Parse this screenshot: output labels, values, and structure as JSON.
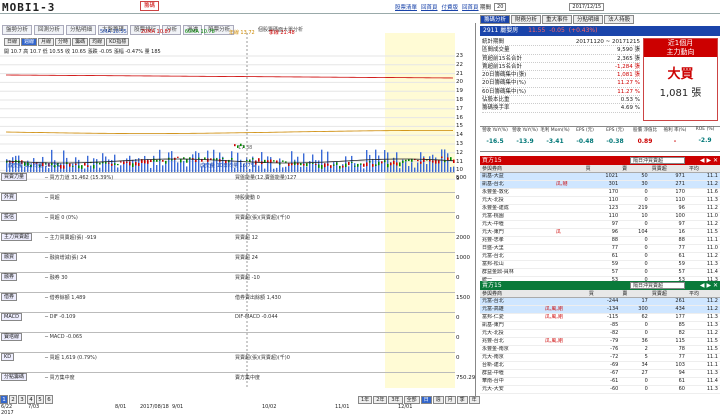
{
  "brand": {
    "logo_text": "MOBI1-3",
    "nav_tabs": [
      "個股",
      "回測分析",
      "分點追蹤",
      "大盤"
    ]
  },
  "header": {
    "tabs": [
      "盤勢分析",
      "回測分析",
      "分點明細",
      "大盤籌碼",
      "股票排行",
      "分析",
      "過濾",
      "股票分析"
    ],
    "active_tab": "籌碼",
    "links": [
      "股票清單",
      "回首頁",
      "付費版",
      "回首頁"
    ],
    "subtitle": "個股籌碼面大單分析"
  },
  "chart": {
    "tabs": [
      "日線",
      "週線",
      "月線",
      "分時",
      "籌碼",
      "均線",
      "KD指標"
    ],
    "active_tab": "日線",
    "ma_legend": [
      {
        "label": "5MA 10.55",
        "color": "#1a44aa"
      },
      {
        "label": "20MA 10.87",
        "color": "#c00"
      },
      {
        "label": "60MA 10.78",
        "color": "#008800"
      },
      {
        "label": "年線 13.72",
        "color": "#cc8800"
      },
      {
        "label": "季線 21.48",
        "color": "#c00"
      }
    ],
    "price_legend": "開 10.7  高 10.7  低 10.55  收 10.65  漲跌 -0.05  漲幅 -0.47%  量 185",
    "y_labels": [
      "23",
      "22",
      "21",
      "20",
      "19",
      "18",
      "17",
      "16",
      "15",
      "14",
      "13",
      "12",
      "11",
      "10",
      "9"
    ],
    "vol_label": "成交量 5日均量 16.7%",
    "vol_label2": "成交量 10日均量 16.7%",
    "crosshair_label": "17.38",
    "panels": [
      {
        "label": "買賣力量",
        "text": "─ 買方力道 31,462 (15.39%)",
        "text2": "買盤能量(12,賣盤能量)127",
        "y": "500"
      },
      {
        "label": "外資",
        "text": "─ 買超",
        "text2": "持股變動 0",
        "y": "0"
      },
      {
        "label": "投信",
        "text": "─ 買超 0 (0%)",
        "text2": "買賣超(張)(買賣超)(千)0",
        "y": "0"
      },
      {
        "label": "主力買賣超",
        "text": "─ 主力買賣超(張) -919",
        "text2": "買賣超 12",
        "y": "2000"
      },
      {
        "label": "融資",
        "text": "─ 融資增減(張) 24",
        "text2": "買賣超 24",
        "y": "1000"
      },
      {
        "label": "融券",
        "text": "─ 融券 30",
        "text2": "買賣超 -10",
        "y": "0"
      },
      {
        "label": "借券",
        "text": "─ 借券餘額 1,489",
        "text2": "借券賣出餘額 1,430",
        "y": "1500"
      },
      {
        "label": "MACD",
        "text": "─ DIF -0.109",
        "text2": "DIF-MACD -0.044",
        "y": "0"
      },
      {
        "label": "寶塔線",
        "text": "─ MACD -0.065",
        "text2": "",
        "y": "0"
      },
      {
        "label": "KD",
        "text": "─ 買超 1,619 (0.79%)",
        "text2": "買賣超(張)(買賣超)(千)0",
        "y": "0"
      },
      {
        "label": "分點籌碼",
        "text": "─ 買方集中度",
        "text2": "賣方集中度",
        "y": "750.29"
      }
    ],
    "x_labels": [
      "6/22\n2017",
      "7/03",
      "8/01",
      "2017/08/18",
      "9/01",
      "10/02",
      "11/01",
      "12/01"
    ],
    "bottom_pages": [
      "1",
      "2",
      "3",
      "4",
      "5",
      "6"
    ],
    "period_tabs": [
      "1年",
      "2年",
      "3年",
      "全部",
      "日",
      "週",
      "月",
      "季",
      "年"
    ]
  },
  "right": {
    "top_label": "期間",
    "top_select": "20",
    "top_date_from": "2017/12/15",
    "tabs": [
      "籌碼分析",
      "財務分析",
      "重大事件",
      "分點明細",
      "法人持股"
    ],
    "active_tab": "籌碼分析",
    "stock": {
      "code": "2911",
      "name": "麗嬰房",
      "price": "11.55",
      "chg": "-0.05",
      "pct": "(+0.43%)"
    },
    "stats": [
      {
        "k": "統計期間",
        "v": "20171120 ~ 20171215"
      },
      {
        "k": "區間成交量",
        "v": "9,590 張"
      },
      {
        "k": "買超前15名合計",
        "v": "2,365 張"
      },
      {
        "k": "賣超前15名合計",
        "v": "-1,284 張"
      },
      {
        "k": "20日籌碼集中(張)",
        "v": "1,081 張"
      },
      {
        "k": "20日籌碼集中(%)",
        "v": "11.27 %"
      },
      {
        "k": "60日籌碼集中(%)",
        "v": "11.27 %"
      },
      {
        "k": "佔股本比重",
        "v": "0.53 %"
      },
      {
        "k": "籌碼換手率",
        "v": "4.69 %"
      }
    ],
    "bigbox": {
      "head1": "近1個月",
      "head2": "主力動向",
      "main": "大買",
      "size": "1,081 張"
    },
    "metrics": [
      {
        "k": "營收 YoY(%)",
        "v": "-16.5"
      },
      {
        "k": "營收 YoY(%)",
        "v": "-13.9"
      },
      {
        "k": "毛利 Mom(%)",
        "v": "-3.41"
      },
      {
        "k": "EPS (元)",
        "v": "-0.48"
      },
      {
        "k": "EPS (元)",
        "v": "-0.38"
      },
      {
        "k": "股價 淨值比",
        "v": "0.89"
      },
      {
        "k": "殖利 率(%)",
        "v": "-"
      },
      {
        "k": "ROE (%)",
        "v": "-2.9"
      }
    ],
    "buy": {
      "title": "買方15",
      "select": "隔日沖買賣超",
      "headers": [
        "參與券商",
        "",
        "買",
        "賣",
        "買賣超",
        "平均"
      ],
      "rows": [
        {
          "name": "凱基-大益",
          "tag": "",
          "b": "1021",
          "s": "50",
          "net": "971",
          "avg": "11.1"
        },
        {
          "name": "凱基-台北",
          "tag": "瓜,剛",
          "b": "301",
          "s": "30",
          "net": "271",
          "avg": "11.2"
        },
        {
          "name": "永豐金-敦化",
          "tag": "",
          "b": "170",
          "s": "0",
          "net": "170",
          "avg": "11.6"
        },
        {
          "name": "元大-北投",
          "tag": "",
          "b": "110",
          "s": "0",
          "net": "110",
          "avg": "11.3"
        },
        {
          "name": "永豐金-建成",
          "tag": "",
          "b": "123",
          "s": "219",
          "net": "96",
          "avg": "11.2"
        },
        {
          "name": "元富-桃園",
          "tag": "",
          "b": "110",
          "s": "10",
          "net": "100",
          "avg": "11.0"
        },
        {
          "name": "元大-中壢",
          "tag": "",
          "b": "97",
          "s": "0",
          "net": "97",
          "avg": "11.2"
        },
        {
          "name": "元大-東門",
          "tag": "瓜",
          "b": "96",
          "s": "104",
          "net": "16",
          "avg": "11.5"
        },
        {
          "name": "兆豐-忠孝",
          "tag": "",
          "b": "88",
          "s": "0",
          "net": "88",
          "avg": "11.1"
        },
        {
          "name": "日盛-大里",
          "tag": "",
          "b": "77",
          "s": "0",
          "net": "77",
          "avg": "11.0"
        },
        {
          "name": "元富-台北",
          "tag": "",
          "b": "61",
          "s": "0",
          "net": "61",
          "avg": "11.2"
        },
        {
          "name": "富邦-松山",
          "tag": "",
          "b": "59",
          "s": "0",
          "net": "59",
          "avg": "11.3"
        },
        {
          "name": "群益金鼎-員林",
          "tag": "",
          "b": "57",
          "s": "0",
          "net": "57",
          "avg": "11.4"
        },
        {
          "name": "統一",
          "tag": "",
          "b": "53",
          "s": "0",
          "net": "53",
          "avg": "11.3"
        },
        {
          "name": "新光",
          "tag": "",
          "b": "50",
          "s": "259",
          "net": "-209",
          "avg": "11.3"
        }
      ]
    },
    "sell": {
      "title": "賣方15",
      "select": "隔日沖買賣超",
      "headers": [
        "參與券商",
        "",
        "買",
        "賣",
        "買賣超",
        "平均"
      ],
      "rows": [
        {
          "name": "元富-台北",
          "tag": "",
          "b": "-244",
          "s": "17",
          "net": "261",
          "avg": "11.2"
        },
        {
          "name": "元富-高雄",
          "tag": "瓜,風,剛",
          "b": "-134",
          "s": "300",
          "net": "434",
          "avg": "11.2"
        },
        {
          "name": "富邦-仁愛",
          "tag": "瓜,風,剛",
          "b": "-115",
          "s": "62",
          "net": "177",
          "avg": "11.3"
        },
        {
          "name": "凱基-東門",
          "tag": "",
          "b": "-85",
          "s": "0",
          "net": "85",
          "avg": "11.3"
        },
        {
          "name": "元大-北投",
          "tag": "",
          "b": "-82",
          "s": "0",
          "net": "82",
          "avg": "11.2"
        },
        {
          "name": "兆豐-台北",
          "tag": "瓜,風,剛",
          "b": "-79",
          "s": "36",
          "net": "115",
          "avg": "11.5"
        },
        {
          "name": "永豐金-南京",
          "tag": "",
          "b": "-76",
          "s": "2",
          "net": "78",
          "avg": "11.5"
        },
        {
          "name": "元大-南京",
          "tag": "",
          "b": "-72",
          "s": "5",
          "net": "77",
          "avg": "11.1"
        },
        {
          "name": "台新-建北",
          "tag": "",
          "b": "-69",
          "s": "34",
          "net": "103",
          "avg": "11.1"
        },
        {
          "name": "群益-中壢",
          "tag": "",
          "b": "-67",
          "s": "27",
          "net": "94",
          "avg": "11.3"
        },
        {
          "name": "華南-台中",
          "tag": "",
          "b": "-61",
          "s": "0",
          "net": "61",
          "avg": "11.4"
        },
        {
          "name": "元大-大安",
          "tag": "",
          "b": "-60",
          "s": "0",
          "net": "60",
          "avg": "11.3"
        }
      ]
    }
  }
}
